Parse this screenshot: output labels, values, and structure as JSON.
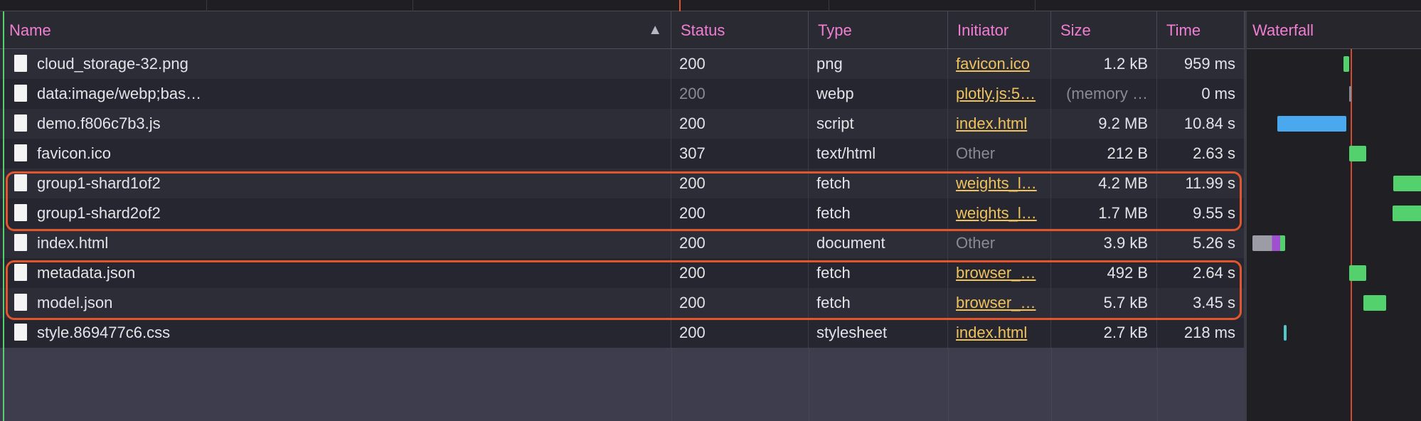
{
  "columns": {
    "name": "Name",
    "status": "Status",
    "type": "Type",
    "initiator": "Initiator",
    "size": "Size",
    "time": "Time",
    "waterfall": "Waterfall"
  },
  "sort_indicator": "▲",
  "rows": [
    {
      "name": "cloud_storage-32.png",
      "status": "200",
      "type": "png",
      "initiator": "favicon.ico",
      "size": "1.2 kB",
      "time": "959 ms"
    },
    {
      "name": "data:image/webp;bas…",
      "status": "200",
      "type": "webp",
      "initiator": "plotly.js:5…",
      "size": "(memory …",
      "time": "0 ms"
    },
    {
      "name": "demo.f806c7b3.js",
      "status": "200",
      "type": "script",
      "initiator": "index.html",
      "size": "9.2 MB",
      "time": "10.84 s"
    },
    {
      "name": "favicon.ico",
      "status": "307",
      "type": "text/html",
      "initiator": "Other",
      "size": "212 B",
      "time": "2.63 s"
    },
    {
      "name": "group1-shard1of2",
      "status": "200",
      "type": "fetch",
      "initiator": "weights_l…",
      "size": "4.2 MB",
      "time": "11.99 s"
    },
    {
      "name": "group1-shard2of2",
      "status": "200",
      "type": "fetch",
      "initiator": "weights_l…",
      "size": "1.7 MB",
      "time": "9.55 s"
    },
    {
      "name": "index.html",
      "status": "200",
      "type": "document",
      "initiator": "Other",
      "size": "3.9 kB",
      "time": "5.26 s"
    },
    {
      "name": "metadata.json",
      "status": "200",
      "type": "fetch",
      "initiator": "browser_…",
      "size": "492 B",
      "time": "2.64 s"
    },
    {
      "name": "model.json",
      "status": "200",
      "type": "fetch",
      "initiator": "browser_…",
      "size": "5.7 kB",
      "time": "3.45 s"
    },
    {
      "name": "style.869477c6.css",
      "status": "200",
      "type": "stylesheet",
      "initiator": "index.html",
      "size": "2.7 kB",
      "time": "218 ms"
    }
  ],
  "colors": {
    "header_text": "#f07fd3",
    "link": "#f0c35a",
    "highlight": "#e2562e",
    "bar_download": "#53d16d",
    "bar_script": "#4aa8ee"
  }
}
